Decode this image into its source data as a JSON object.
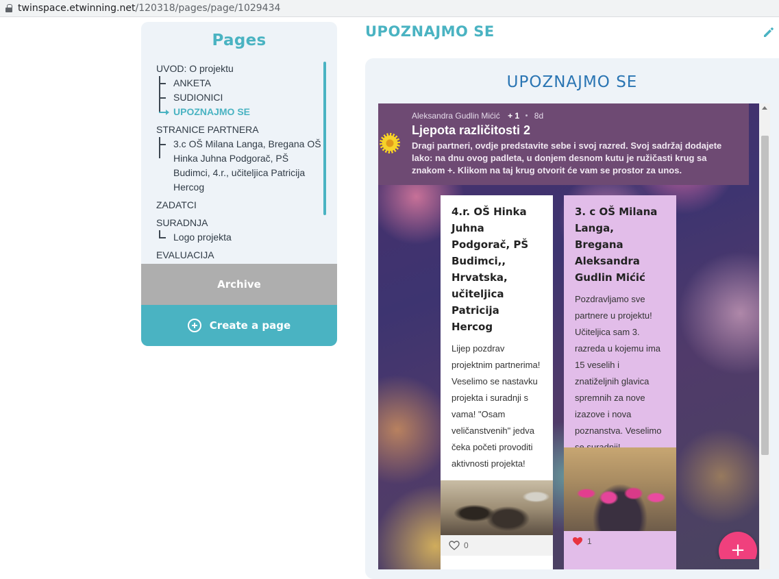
{
  "browser": {
    "url_host": "twinspace.etwinning.net",
    "url_path": "/120318/pages/page/1029434"
  },
  "sidebar": {
    "title": "Pages",
    "items": [
      {
        "label": "UVOD: O projektu",
        "level": 1
      },
      {
        "label": "ANKETA",
        "level": 2
      },
      {
        "label": "SUDIONICI",
        "level": 2
      },
      {
        "label": "UPOZNAJMO SE",
        "level": 2,
        "active": true
      },
      {
        "label": "STRANICE PARTNERA",
        "level": 1
      },
      {
        "label": "3.c OŠ Milana Langa, Bregana OŠ Hinka Juhna Podgorač, PŠ Budimci, 4.r., učiteljica Patricija Hercog",
        "level": 2
      },
      {
        "label": "ZADATCI",
        "level": 1
      },
      {
        "label": "SURADNJA",
        "level": 1
      },
      {
        "label": "Logo projekta",
        "level": 2
      },
      {
        "label": "EVALUACIJA",
        "level": 1
      }
    ],
    "archive_label": "Archive",
    "create_label": "Create a page"
  },
  "main": {
    "page_title": "UPOZNAJMO SE",
    "content_heading": "UPOZNAJMO SE"
  },
  "padlet": {
    "author": "Aleksandra Gudlin Mićić",
    "plus_count": "+ 1",
    "age": "8d",
    "title": "Ljepota različitosti 2",
    "description": "Dragi partneri, ovdje predstavite sebe i svoj razred. Svoj sadržaj dodajete lako: na dnu ovog padleta, u donjem desnom kutu je ružičasti krug sa znakom +. Klikom na taj krug otvorit će vam se prostor za unos.",
    "posts": [
      {
        "title": "4.r. OŠ Hinka Juhna Podgorač, PŠ Budimci,, Hrvatska, učiteljica Patricija Hercog",
        "body": "Lijep pozdrav projektnim partnerima! Veselimo se nastavku projekta i suradnji s vama! \"Osam veličanstvenih\" jedva čeka početi provoditi aktivnosti projekta!",
        "likes": "0",
        "liked": false
      },
      {
        "title": "3. c OŠ Milana Langa, Bregana Aleksandra Gudlin Mićić",
        "body": "Pozdravljamo sve partnere u projektu! Učiteljica sam 3. razreda u kojemu ima 15 veselih i znatiželjnih glavica spremnih za nove izazove i nova poznanstva. Veselimo se suradnji!",
        "likes": "1",
        "liked": true
      }
    ],
    "fab_label": "+"
  },
  "colors": {
    "accent": "#4ab3c2",
    "heading_blue": "#2a75b3",
    "padlet_header": "#6e4a73",
    "post_pink": "#e2bde9",
    "fab": "#f0407d",
    "archive": "#aeaeae"
  },
  "icons": [
    "lock-icon",
    "plus-circle-icon",
    "pencil-icon",
    "sunflower-icon",
    "heart-icon"
  ]
}
